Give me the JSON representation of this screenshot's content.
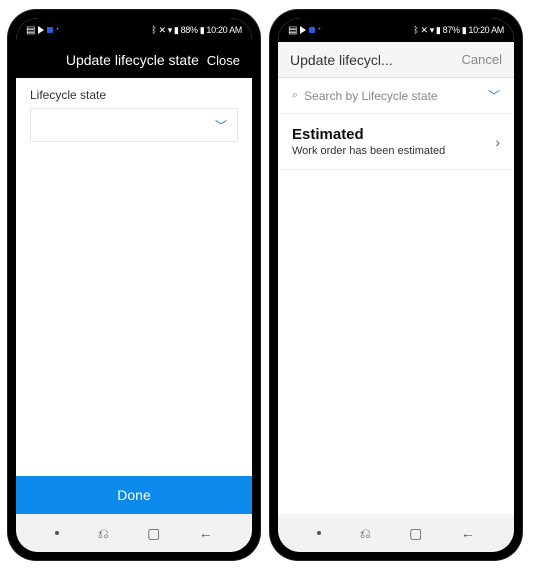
{
  "phones": [
    {
      "status_bar": {
        "battery": "88%",
        "time": "10:20 AM"
      },
      "header": {
        "title": "Update lifecycle state",
        "action": "Close"
      },
      "field_label": "Lifecycle state",
      "done_label": "Done"
    },
    {
      "status_bar": {
        "battery": "87%",
        "time": "10:20 AM"
      },
      "header": {
        "title": "Update lifecycl...",
        "action": "Cancel"
      },
      "search_placeholder": "Search by Lifecycle state",
      "list": [
        {
          "title": "Estimated",
          "subtitle": "Work order has been estimated"
        }
      ]
    }
  ]
}
